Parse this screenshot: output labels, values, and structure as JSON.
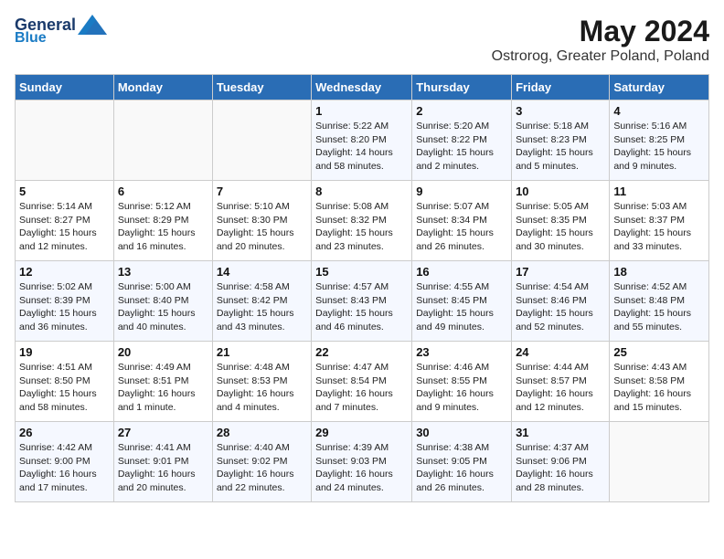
{
  "header": {
    "logo_line1": "General",
    "logo_line2": "Blue",
    "title": "May 2024",
    "subtitle": "Ostrorog, Greater Poland, Poland"
  },
  "weekdays": [
    "Sunday",
    "Monday",
    "Tuesday",
    "Wednesday",
    "Thursday",
    "Friday",
    "Saturday"
  ],
  "weeks": [
    [
      {
        "day": "",
        "info": ""
      },
      {
        "day": "",
        "info": ""
      },
      {
        "day": "",
        "info": ""
      },
      {
        "day": "1",
        "info": "Sunrise: 5:22 AM\nSunset: 8:20 PM\nDaylight: 14 hours and 58 minutes."
      },
      {
        "day": "2",
        "info": "Sunrise: 5:20 AM\nSunset: 8:22 PM\nDaylight: 15 hours and 2 minutes."
      },
      {
        "day": "3",
        "info": "Sunrise: 5:18 AM\nSunset: 8:23 PM\nDaylight: 15 hours and 5 minutes."
      },
      {
        "day": "4",
        "info": "Sunrise: 5:16 AM\nSunset: 8:25 PM\nDaylight: 15 hours and 9 minutes."
      }
    ],
    [
      {
        "day": "5",
        "info": "Sunrise: 5:14 AM\nSunset: 8:27 PM\nDaylight: 15 hours and 12 minutes."
      },
      {
        "day": "6",
        "info": "Sunrise: 5:12 AM\nSunset: 8:29 PM\nDaylight: 15 hours and 16 minutes."
      },
      {
        "day": "7",
        "info": "Sunrise: 5:10 AM\nSunset: 8:30 PM\nDaylight: 15 hours and 20 minutes."
      },
      {
        "day": "8",
        "info": "Sunrise: 5:08 AM\nSunset: 8:32 PM\nDaylight: 15 hours and 23 minutes."
      },
      {
        "day": "9",
        "info": "Sunrise: 5:07 AM\nSunset: 8:34 PM\nDaylight: 15 hours and 26 minutes."
      },
      {
        "day": "10",
        "info": "Sunrise: 5:05 AM\nSunset: 8:35 PM\nDaylight: 15 hours and 30 minutes."
      },
      {
        "day": "11",
        "info": "Sunrise: 5:03 AM\nSunset: 8:37 PM\nDaylight: 15 hours and 33 minutes."
      }
    ],
    [
      {
        "day": "12",
        "info": "Sunrise: 5:02 AM\nSunset: 8:39 PM\nDaylight: 15 hours and 36 minutes."
      },
      {
        "day": "13",
        "info": "Sunrise: 5:00 AM\nSunset: 8:40 PM\nDaylight: 15 hours and 40 minutes."
      },
      {
        "day": "14",
        "info": "Sunrise: 4:58 AM\nSunset: 8:42 PM\nDaylight: 15 hours and 43 minutes."
      },
      {
        "day": "15",
        "info": "Sunrise: 4:57 AM\nSunset: 8:43 PM\nDaylight: 15 hours and 46 minutes."
      },
      {
        "day": "16",
        "info": "Sunrise: 4:55 AM\nSunset: 8:45 PM\nDaylight: 15 hours and 49 minutes."
      },
      {
        "day": "17",
        "info": "Sunrise: 4:54 AM\nSunset: 8:46 PM\nDaylight: 15 hours and 52 minutes."
      },
      {
        "day": "18",
        "info": "Sunrise: 4:52 AM\nSunset: 8:48 PM\nDaylight: 15 hours and 55 minutes."
      }
    ],
    [
      {
        "day": "19",
        "info": "Sunrise: 4:51 AM\nSunset: 8:50 PM\nDaylight: 15 hours and 58 minutes."
      },
      {
        "day": "20",
        "info": "Sunrise: 4:49 AM\nSunset: 8:51 PM\nDaylight: 16 hours and 1 minute."
      },
      {
        "day": "21",
        "info": "Sunrise: 4:48 AM\nSunset: 8:53 PM\nDaylight: 16 hours and 4 minutes."
      },
      {
        "day": "22",
        "info": "Sunrise: 4:47 AM\nSunset: 8:54 PM\nDaylight: 16 hours and 7 minutes."
      },
      {
        "day": "23",
        "info": "Sunrise: 4:46 AM\nSunset: 8:55 PM\nDaylight: 16 hours and 9 minutes."
      },
      {
        "day": "24",
        "info": "Sunrise: 4:44 AM\nSunset: 8:57 PM\nDaylight: 16 hours and 12 minutes."
      },
      {
        "day": "25",
        "info": "Sunrise: 4:43 AM\nSunset: 8:58 PM\nDaylight: 16 hours and 15 minutes."
      }
    ],
    [
      {
        "day": "26",
        "info": "Sunrise: 4:42 AM\nSunset: 9:00 PM\nDaylight: 16 hours and 17 minutes."
      },
      {
        "day": "27",
        "info": "Sunrise: 4:41 AM\nSunset: 9:01 PM\nDaylight: 16 hours and 20 minutes."
      },
      {
        "day": "28",
        "info": "Sunrise: 4:40 AM\nSunset: 9:02 PM\nDaylight: 16 hours and 22 minutes."
      },
      {
        "day": "29",
        "info": "Sunrise: 4:39 AM\nSunset: 9:03 PM\nDaylight: 16 hours and 24 minutes."
      },
      {
        "day": "30",
        "info": "Sunrise: 4:38 AM\nSunset: 9:05 PM\nDaylight: 16 hours and 26 minutes."
      },
      {
        "day": "31",
        "info": "Sunrise: 4:37 AM\nSunset: 9:06 PM\nDaylight: 16 hours and 28 minutes."
      },
      {
        "day": "",
        "info": ""
      }
    ]
  ]
}
